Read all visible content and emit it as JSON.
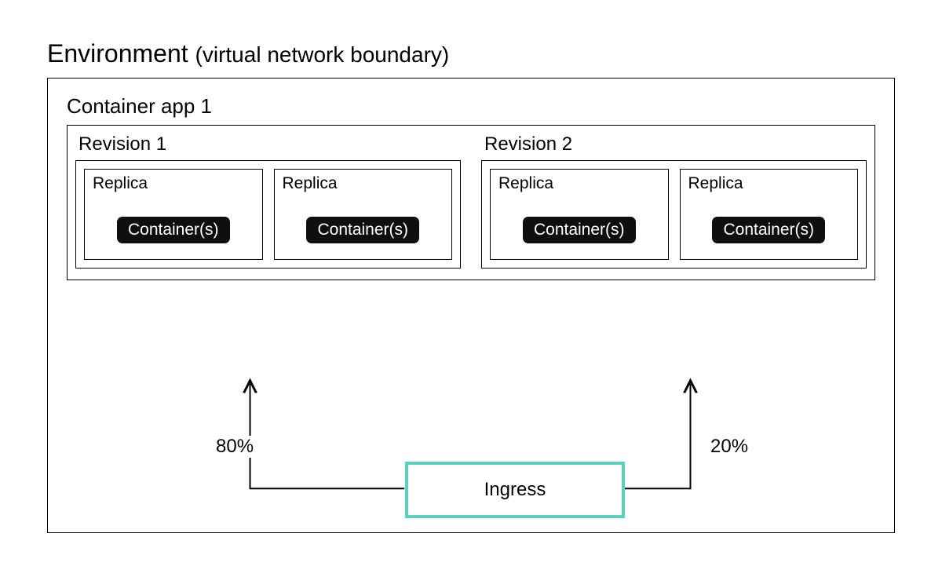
{
  "title_main": "Environment",
  "title_sub": "(virtual network boundary)",
  "app_label": "Container app 1",
  "revisions": [
    {
      "label": "Revision 1",
      "replicas": [
        {
          "label": "Replica",
          "container": "Container(s)"
        },
        {
          "label": "Replica",
          "container": "Container(s)"
        }
      ]
    },
    {
      "label": "Revision 2",
      "replicas": [
        {
          "label": "Replica",
          "container": "Container(s)"
        },
        {
          "label": "Replica",
          "container": "Container(s)"
        }
      ]
    }
  ],
  "ingress_label": "Ingress",
  "traffic_split": {
    "left": "80%",
    "right": "20%"
  }
}
